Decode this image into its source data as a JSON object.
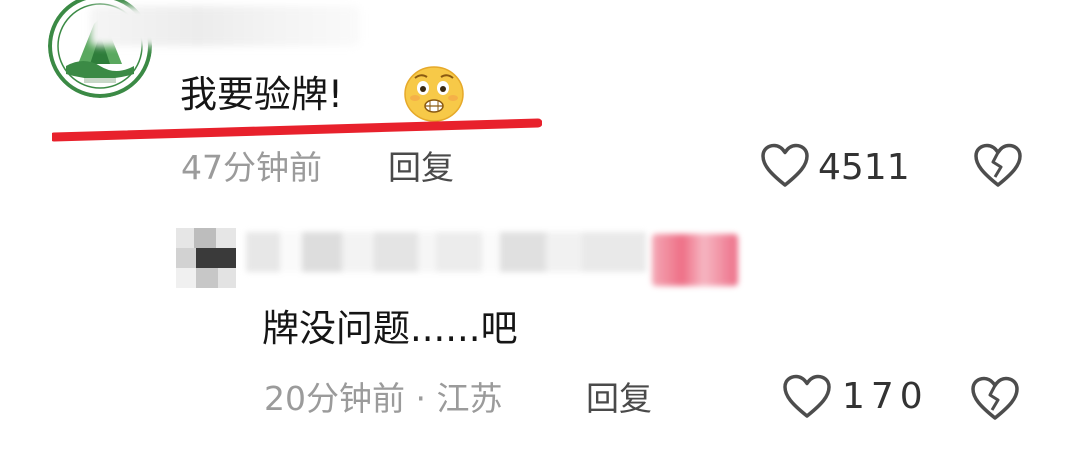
{
  "comments": [
    {
      "text": "我要验牌!",
      "emoji": "worried-face-emoji",
      "time": "47分钟前",
      "reply_label": "回复",
      "like_count": "4511",
      "icons": {
        "like": "heart-outline-icon",
        "dislike": "broken-heart-icon"
      }
    },
    {
      "text": "牌没问题......吧",
      "meta": "20分钟前 · 江苏",
      "reply_label": "回复",
      "like_count": "170",
      "icons": {
        "like": "heart-outline-icon",
        "dislike": "broken-heart-icon"
      }
    }
  ],
  "colors": {
    "annotation_underline": "#e8212c",
    "meta_text": "#9b9b9b",
    "body_text": "#151515",
    "icon_stroke": "#4d4d4d",
    "avatar_green": "#2e7d3a",
    "blur_badge": "#ee6f86"
  }
}
